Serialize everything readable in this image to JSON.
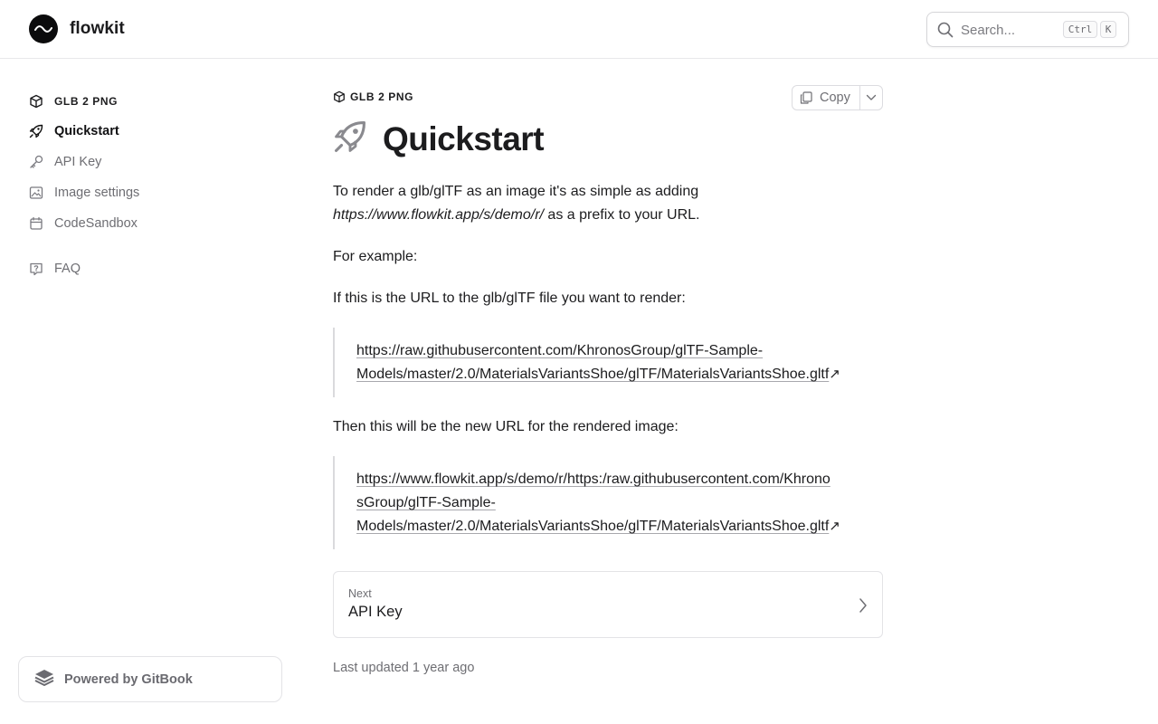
{
  "header": {
    "brand": "flowkit",
    "search_placeholder": "Search...",
    "shortcut_ctrl": "Ctrl",
    "shortcut_key": "K"
  },
  "sidebar": {
    "items": [
      {
        "label": "GLB 2 PNG",
        "icon": "cube-icon"
      },
      {
        "label": "Quickstart",
        "icon": "rocket-icon",
        "active": true
      },
      {
        "label": "API Key",
        "icon": "key-icon"
      },
      {
        "label": "Image settings",
        "icon": "image-icon"
      },
      {
        "label": "CodeSandbox",
        "icon": "sandbox-icon"
      },
      {
        "label": "FAQ",
        "icon": "question-icon"
      }
    ],
    "powered_by": "Powered by GitBook"
  },
  "page": {
    "breadcrumb": "GLB 2 PNG",
    "copy_label": "Copy",
    "title": "Quickstart",
    "intro_text": "To render a glb/glTF as an image it's as simple as adding",
    "intro_url": "https://www.flowkit.app/s/demo/r/",
    "intro_suffix": " as a prefix to your URL.",
    "for_example": "For example:",
    "if_this": "If this is the URL to the glb/glTF file you want to render:",
    "source_url_line1": "https://raw.githubusercontent.com/KhronosGroup/glTF-Sample-",
    "source_url_line2": "Models/master/2.0/MaterialsVariantsShoe/glTF/MaterialsVariantsShoe.gltf",
    "then_text": "Then this will be the new URL for the rendered image:",
    "render_url_line1": "https://www.flowkit.app/s/demo/r/https:/raw.githubusercontent.com/Khrono",
    "render_url_line2": "sGroup/glTF-Sample-",
    "render_url_line3": "Models/master/2.0/MaterialsVariantsShoe/glTF/MaterialsVariantsShoe.gltf",
    "external_arrow": "↗",
    "next_label": "Next",
    "next_title": "API Key",
    "last_updated": "Last updated 1 year ago"
  },
  "colors": {
    "text": "#1c1c1e",
    "muted": "#6e6e73",
    "border": "#e3e3e6"
  }
}
